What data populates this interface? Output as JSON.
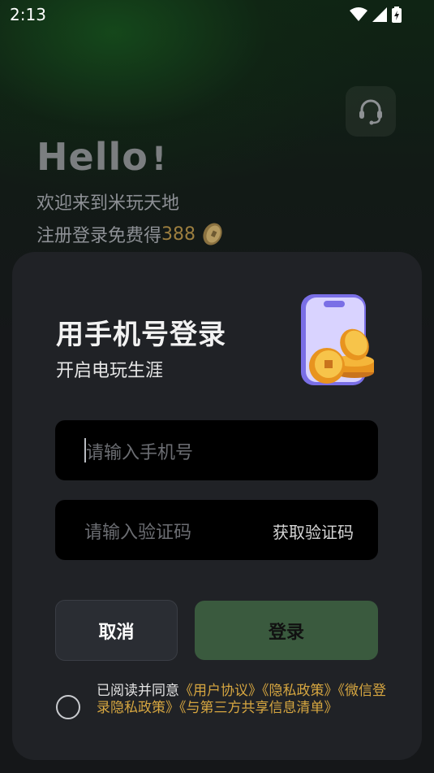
{
  "status_bar": {
    "time": "2:13"
  },
  "header": {
    "greeting": "Hello",
    "greeting_mark": "!",
    "welcome": "欢迎来到米玩天地",
    "reward_prefix": "注册登录免费得",
    "reward_amount": "388"
  },
  "card": {
    "title": "用手机号登录",
    "subtitle": "开启电玩生涯",
    "phone_input": {
      "placeholder": "请输入手机号",
      "value": ""
    },
    "code_input": {
      "placeholder": "请输入验证码",
      "value": ""
    },
    "get_code_label": "获取验证码",
    "cancel_label": "取消",
    "login_label": "登录",
    "agreement": {
      "prefix": "已阅读并同意",
      "links": [
        "《用户协议》",
        "《隐私政策》",
        "《微信登录隐私政策》",
        "《与第三方共享信息清单》"
      ]
    }
  },
  "colors": {
    "accent_gold": "#d6a640",
    "login_button": "#3a5a3e",
    "card_bg": "#202226"
  }
}
